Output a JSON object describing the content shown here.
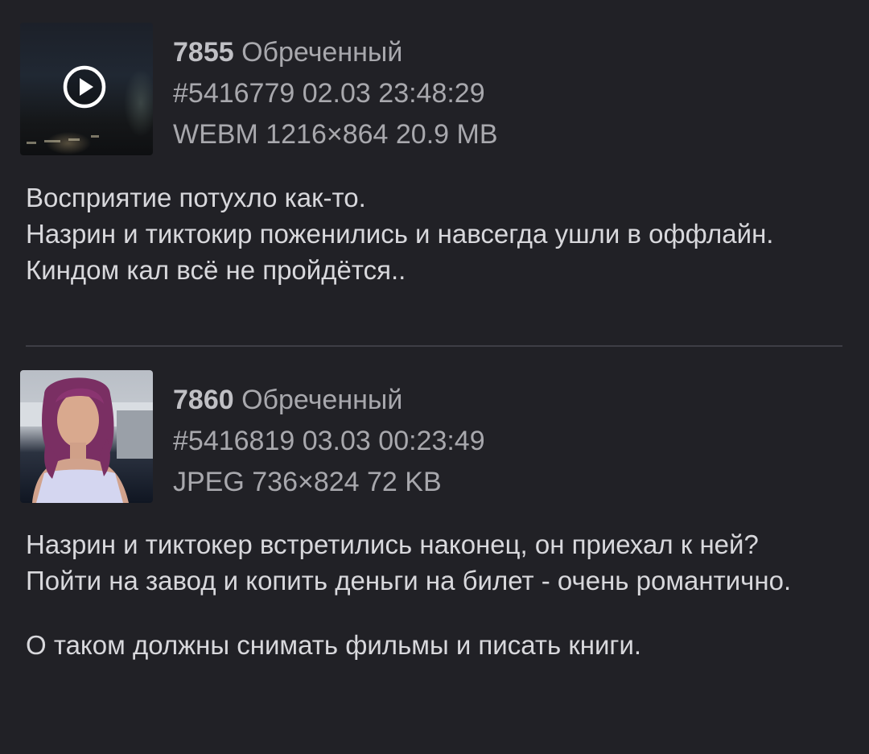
{
  "posts": [
    {
      "post_number": "7855",
      "author": "Обреченный",
      "post_id": "#5416779",
      "date": "02.03",
      "time": "23:48:29",
      "file_info": "WEBM 1216×864 20.9 MB",
      "media_icon": "play-icon",
      "lines": [
        "Восприятие потухло как-то.",
        "Назрин и тиктокир поженились и навсегда ушли в оффлайн.",
        "Киндом кал всё не пройдётся.."
      ]
    },
    {
      "post_number": "7860",
      "author": "Обреченный",
      "post_id": "#5416819",
      "date": "03.03",
      "time": "00:23:49",
      "file_info": "JPEG 736×824 72 KB",
      "lines": [
        "Назрин и тиктокер встретились наконец, он приехал к ней?",
        "Пойти на завод и копить деньги на билет - очень романтично.",
        "",
        "О таком должны снимать фильмы и писать книги."
      ]
    }
  ],
  "colors": {
    "background": "#212126",
    "text": "#d8d8dc",
    "meta": "#a8a8ad",
    "divider": "#3e3e45"
  }
}
